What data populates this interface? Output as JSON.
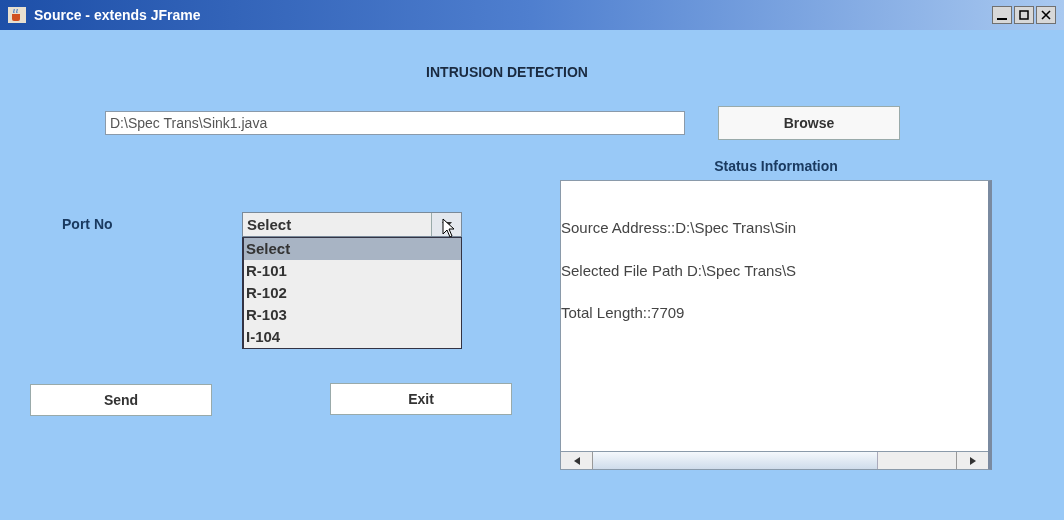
{
  "window": {
    "title": "Source - extends JFrame"
  },
  "heading": "INTRUSION DETECTION",
  "file_field": {
    "value": "D:\\Spec Trans\\Sink1.java"
  },
  "browse_button": "Browse",
  "port": {
    "label": "Port No",
    "value": "Select",
    "expanded": true,
    "options": [
      {
        "label": "Select",
        "selected": true
      },
      {
        "label": "R-101",
        "selected": false
      },
      {
        "label": "R-102",
        "selected": false
      },
      {
        "label": "R-103",
        "selected": false
      },
      {
        "label": "I-104",
        "selected": false
      }
    ]
  },
  "buttons": [
    "Send",
    "Exit"
  ],
  "status": {
    "title": "Status Information",
    "lines": [
      "Source Address::D:\\Spec Trans\\Sin",
      "Selected File Path D:\\Spec Trans\\S",
      "Total Length::7709"
    ]
  }
}
